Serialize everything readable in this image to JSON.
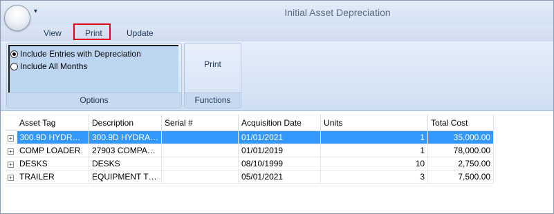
{
  "window": {
    "title": "Initial Asset Depreciation",
    "qat_icon": "dropdown-arrow"
  },
  "tabs": [
    {
      "label": "View"
    },
    {
      "label": "Print",
      "highlighted": true
    },
    {
      "label": "Update"
    }
  ],
  "ribbon": {
    "options": {
      "label": "Options",
      "radios": [
        {
          "label": "Include Entries with Depreciation",
          "checked": true
        },
        {
          "label": "Include All Months",
          "checked": false
        }
      ]
    },
    "functions": {
      "label": "Functions",
      "print_label": "Print"
    }
  },
  "grid": {
    "columns": [
      "Asset Tag",
      "Description",
      "Serial #",
      "Acquisition Date",
      "Units",
      "Total Cost"
    ],
    "rows": [
      {
        "asset_tag": "300.9D HYDR…",
        "description": "300.9D HYDRA…",
        "serial": "",
        "acq_date": "01/01/2021",
        "units": "1",
        "total_cost": "35,000.00",
        "selected": true
      },
      {
        "asset_tag": "COMP LOADER",
        "description": "27903 COMPA…",
        "serial": "",
        "acq_date": "01/01/2019",
        "units": "1",
        "total_cost": "78,000.00"
      },
      {
        "asset_tag": "DESKS",
        "description": "DESKS",
        "serial": "",
        "acq_date": "08/10/1999",
        "units": "10",
        "total_cost": "2,750.00"
      },
      {
        "asset_tag": "TRAILER",
        "description": "EQUIPMENT T…",
        "serial": "",
        "acq_date": "05/01/2021",
        "units": "3",
        "total_cost": "7,500.00"
      }
    ]
  },
  "colors": {
    "selection": "#3399ff",
    "highlight_border": "#e0001b",
    "ribbon_bg": "#dbe6f4"
  }
}
